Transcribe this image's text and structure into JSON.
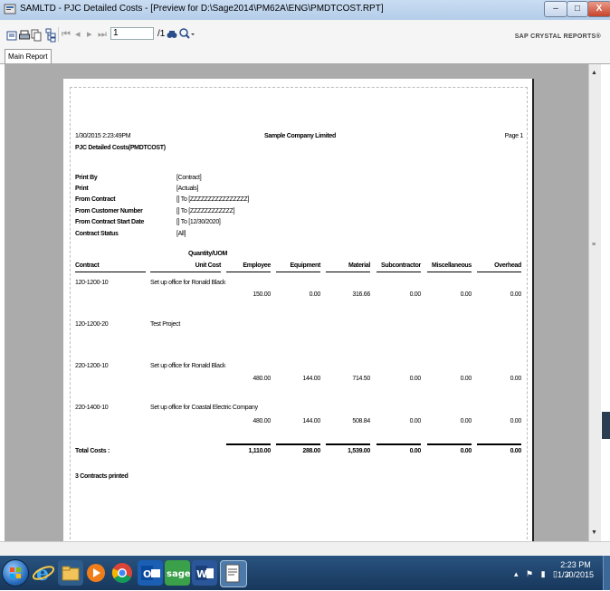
{
  "window": {
    "title": "SAMLTD - PJC Detailed Costs - [Preview for D:\\Sage2014\\PM62A\\ENG\\PMDTCOST.RPT]",
    "min": "–",
    "max": "□",
    "close": "X"
  },
  "toolbar": {
    "page_value": "1",
    "page_total": "/1",
    "brand": "SAP CRYSTAL REPORTS®"
  },
  "tabs": {
    "main": "Main Report"
  },
  "report": {
    "timestamp": "1/30/2015  2:23:49PM",
    "company": "Sample Company Limited",
    "page": "Page 1",
    "title": "PJC Detailed Costs(PMDTCOST)",
    "params": [
      {
        "label": "Print By",
        "value": "[Contract]"
      },
      {
        "label": "Print",
        "value": "[Actuals]"
      },
      {
        "label": "From Contract",
        "value": "[] To [ZZZZZZZZZZZZZZZZ]"
      },
      {
        "label": "From Customer Number",
        "value": "[] To [ZZZZZZZZZZZZ]"
      },
      {
        "label": "From Contract Start Date",
        "value": "[] To [12/30/2020]"
      },
      {
        "label": "Contract Status",
        "value": "[All]"
      }
    ],
    "headers": {
      "quantity_uom": "Quantity/UOM",
      "contract": "Contract",
      "unit_cost": "Unit Cost",
      "employee": "Employee",
      "equipment": "Equipment",
      "material": "Material",
      "subcontractor": "Subcontractor",
      "miscellaneous": "Miscellaneous",
      "overhead": "Overhead"
    },
    "rows": [
      {
        "contract": "120-1200-10",
        "desc": "Set up office for Ronald Black",
        "employee": "150.00",
        "equipment": "0.00",
        "material": "316.66",
        "subcontractor": "0.00",
        "miscellaneous": "0.00",
        "overhead": "0.00"
      },
      {
        "contract": "120-1200-20",
        "desc": "Test Project"
      },
      {
        "contract": "220-1200-10",
        "desc": "Set up office for Ronald Black",
        "employee": "480.00",
        "equipment": "144.00",
        "material": "714.50",
        "subcontractor": "0.00",
        "miscellaneous": "0.00",
        "overhead": "0.00"
      },
      {
        "contract": "220-1400-10",
        "desc": "Set up office for Coastal Electric Company",
        "employee": "480.00",
        "equipment": "144.00",
        "material": "508.84",
        "subcontractor": "0.00",
        "miscellaneous": "0.00",
        "overhead": "0.00"
      }
    ],
    "totals": {
      "label": "Total Costs :",
      "employee": "1,110.00",
      "equipment": "288.00",
      "material": "1,539.00",
      "subcontractor": "0.00",
      "miscellaneous": "0.00",
      "overhead": "0.00"
    },
    "footer": "3 Contracts printed"
  },
  "taskbar": {
    "time": "2:23 PM",
    "date": "1/30/2015"
  }
}
